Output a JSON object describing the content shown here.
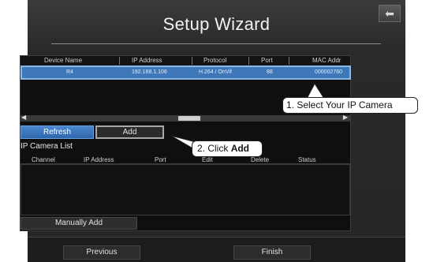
{
  "window": {
    "title": "Setup Wizard",
    "back_icon": "back-arrow-icon"
  },
  "device_table": {
    "columns": [
      "Device Name",
      "IP Address",
      "Protocol",
      "Port",
      "MAC Addr"
    ],
    "rows": [
      {
        "device_name": "R4",
        "ip_address": "192.168.1.106",
        "protocol": "H.264 / OnVif",
        "port": "88",
        "mac": "000002760"
      }
    ]
  },
  "buttons": {
    "refresh": "Refresh",
    "add": "Add",
    "manually_add": "Manually Add",
    "previous": "Previous",
    "finish": "Finish"
  },
  "camera_list": {
    "label": "IP Camera List",
    "columns": [
      "Channel",
      "IP Address",
      "Port",
      "Edit",
      "Delete",
      "Status"
    ]
  },
  "callouts": {
    "step1": "1. Select Your IP Camera",
    "step2_prefix": "2. Click ",
    "step2_bold": "Add"
  },
  "scrollbar": {
    "left_icon": "left-arrow-icon",
    "right_icon": "right-arrow-icon"
  },
  "colors": {
    "selected_row": "#3e78b8",
    "refresh_button": "#3a78c0",
    "window_bg": "#2a2a2a"
  }
}
